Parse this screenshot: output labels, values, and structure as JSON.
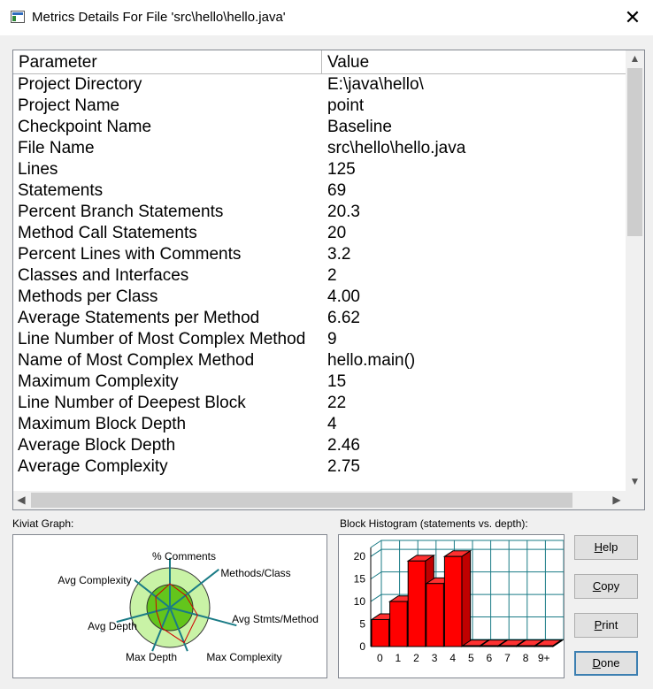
{
  "window": {
    "title": "Metrics Details For File 'src\\hello\\hello.java'",
    "close_glyph": "✕"
  },
  "table": {
    "columns": [
      "Parameter",
      "Value"
    ],
    "rows": [
      [
        "Project Directory",
        "E:\\java\\hello\\"
      ],
      [
        "Project Name",
        "point"
      ],
      [
        "Checkpoint Name",
        "Baseline"
      ],
      [
        "File Name",
        "src\\hello\\hello.java"
      ],
      [
        "Lines",
        "125"
      ],
      [
        "Statements",
        "69"
      ],
      [
        "Percent Branch Statements",
        "20.3"
      ],
      [
        "Method Call Statements",
        "20"
      ],
      [
        "Percent Lines with Comments",
        "3.2"
      ],
      [
        "Classes and Interfaces",
        "2"
      ],
      [
        "Methods per Class",
        "4.00"
      ],
      [
        "Average Statements per Method",
        "6.62"
      ],
      [
        "Line Number of Most Complex Method",
        "9"
      ],
      [
        "Name of Most Complex Method",
        "hello.main()"
      ],
      [
        "Maximum Complexity",
        "15"
      ],
      [
        "Line Number of Deepest Block",
        "22"
      ],
      [
        "Maximum Block Depth",
        "4"
      ],
      [
        "Average Block Depth",
        "2.46"
      ],
      [
        "Average Complexity",
        "2.75"
      ]
    ]
  },
  "kiviat": {
    "label": "Kiviat Graph:",
    "axes": [
      "% Comments",
      "Methods/Class",
      "Avg Stmts/Method",
      "Max Complexity",
      "Max Depth",
      "Avg Depth",
      "Avg Complexity"
    ],
    "colors": {
      "outer_ring": "#c9f3a6",
      "inner_ring": "#63c51c",
      "axis": "#1a7b86",
      "polygon": "#d00000"
    }
  },
  "chart_data": {
    "type": "bar",
    "title": "Block Histogram (statements vs. depth):",
    "categories": [
      "0",
      "1",
      "2",
      "3",
      "4",
      "5",
      "6",
      "7",
      "8",
      "9+"
    ],
    "values": [
      6,
      10,
      19,
      14,
      20,
      0,
      0,
      0,
      0,
      0
    ],
    "y_ticks": [
      "0",
      "5",
      "10",
      "15",
      "20"
    ],
    "ylim": [
      0,
      22
    ],
    "grid": true,
    "colors": {
      "bar": "#ff0000",
      "grid": "#1a7b86",
      "plot_bg": "#ffffff"
    }
  },
  "buttons": [
    {
      "label": "Help",
      "mnemonic": "H"
    },
    {
      "label": "Copy",
      "mnemonic": "C"
    },
    {
      "label": "Print",
      "mnemonic": "P"
    },
    {
      "label": "Done",
      "mnemonic": "D"
    }
  ],
  "scrollbar_glyphs": {
    "up": "▲",
    "down": "▼",
    "left": "◀",
    "right": "▶"
  }
}
